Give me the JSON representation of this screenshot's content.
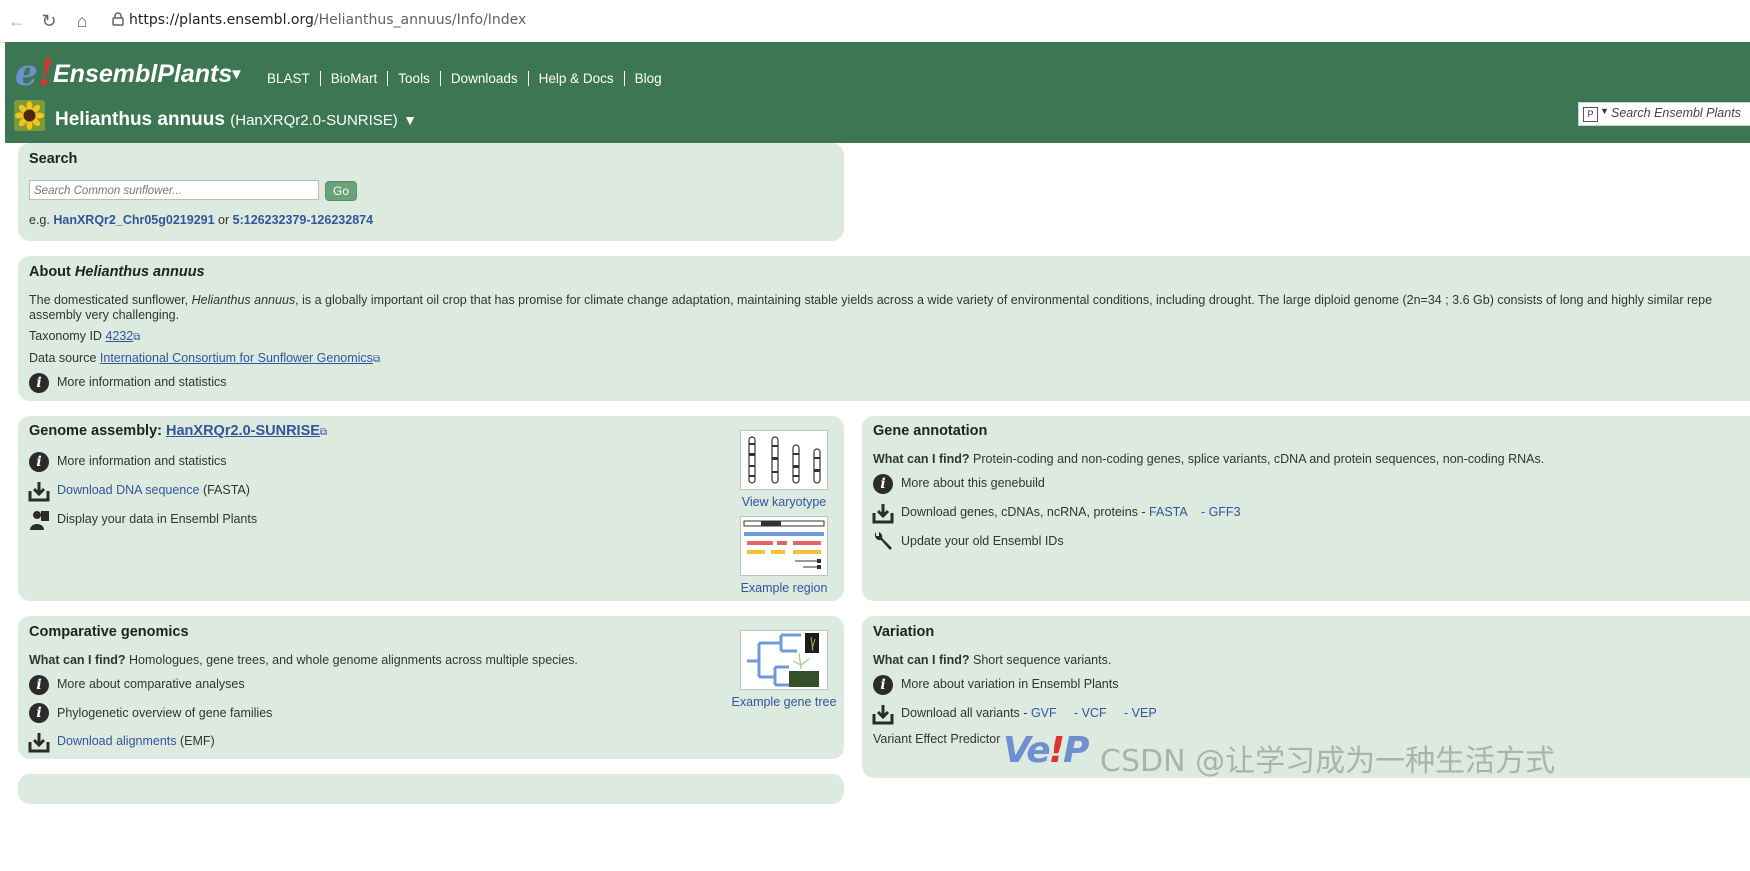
{
  "browser": {
    "url_host": "https://plants.ensembl.org",
    "url_path": "/Helianthus_annuus/Info/Index"
  },
  "header": {
    "logo_text": "EnsemblPlants",
    "nav": [
      "BLAST",
      "BioMart",
      "Tools",
      "Downloads",
      "Help & Docs",
      "Blog"
    ],
    "species_name": "Helianthus annuus",
    "species_assembly": "(HanXRQr2.0-SUNRISE)",
    "search_placeholder": "Search Ensembl Plants",
    "colors": {
      "header_bg": "#3d7652",
      "panel_bg": "#dceae0",
      "link": "#33559a"
    }
  },
  "search": {
    "title": "Search",
    "placeholder": "Search Common sunflower...",
    "go": "Go",
    "example_prefix": "e.g.",
    "example_gene": "HanXRQr2_Chr05g0219291",
    "example_or": "or",
    "example_region": "5:126232379-126232874"
  },
  "about": {
    "title_prefix": "About",
    "title_species": "Helianthus annuus",
    "desc_1": "The domesticated sunflower,",
    "desc_species": "Helianthus annuus",
    "desc_2": ", is a globally important oil crop that has promise for climate change adaptation, maintaining stable yields across a wide variety of environmental conditions, including drought. The large diploid genome (2n=34 ; 3.6 Gb) consists of long and highly similar repe",
    "desc_line2": "assembly very challenging.",
    "taxonomy_label": "Taxonomy ID",
    "taxonomy_id": "4232",
    "data_source_label": "Data source",
    "data_source": "International Consortium for Sunflower Genomics",
    "more_info": "More information and statistics"
  },
  "genome": {
    "title_prefix": "Genome assembly:",
    "assembly": "HanXRQr2.0-SUNRISE",
    "more_info": "More information and statistics",
    "download_dna": "Download DNA sequence",
    "download_dna_fmt": "(FASTA)",
    "display_data": "Display your data in Ensembl Plants",
    "view_karyotype": "View karyotype",
    "example_region": "Example region"
  },
  "gene_annotation": {
    "title": "Gene annotation",
    "what_label": "What can I find?",
    "what_text": "Protein-coding and non-coding genes, splice variants, cDNA and protein sequences, non-coding RNAs.",
    "more_about": "More about this genebuild",
    "download_label": "Download genes, cDNAs, ncRNA, proteins -",
    "fasta": "FASTA",
    "gff3": "- GFF3",
    "update_ids": "Update your old Ensembl IDs"
  },
  "comparative": {
    "title": "Comparative genomics",
    "what_label": "What can I find?",
    "what_text": "Homologues, gene trees, and whole genome alignments across multiple species.",
    "more_about": "More about comparative analyses",
    "phylo": "Phylogenetic overview of gene families",
    "download_alignments": "Download alignments",
    "download_fmt": "(EMF)",
    "example_gene_tree": "Example gene tree"
  },
  "variation": {
    "title": "Variation",
    "what_label": "What can I find?",
    "what_text": "Short sequence variants.",
    "more_about": "More about variation in Ensembl Plants",
    "download_label": "Download all variants -",
    "gvf": "GVF",
    "vcf": "- VCF",
    "vep": "- VEP",
    "vep_link": "Variant Effect Predictor",
    "vep_logo_1": "Ve",
    "vep_logo_2": "!",
    "vep_logo_3": "P"
  },
  "watermark": "CSDN @让学习成为一种生活方式"
}
